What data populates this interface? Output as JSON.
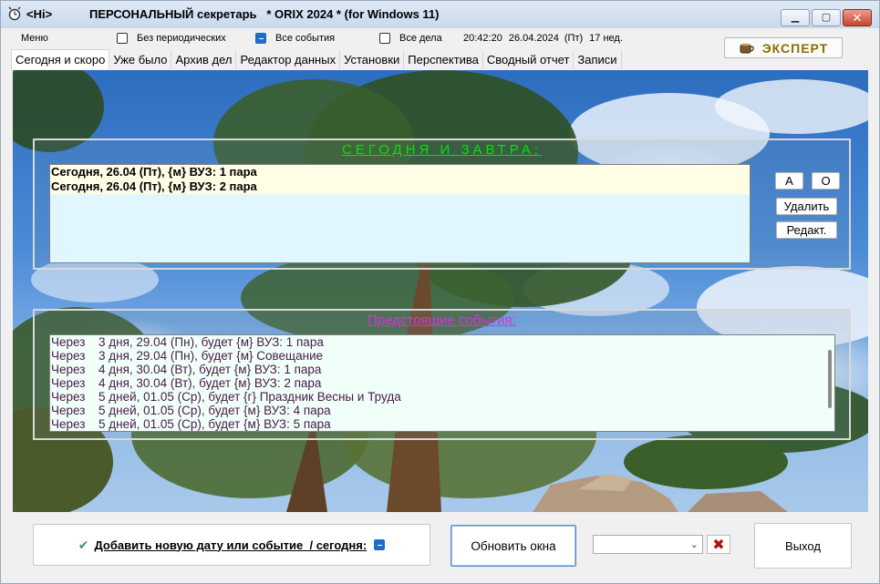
{
  "window": {
    "tag": "<Hi>",
    "title": "ПЕРСОНАЛЬНЫЙ секретарь   * ORIX 2024 * (for Windows 11)"
  },
  "options": {
    "menu": "Меню",
    "no_periodic": "Без периодических",
    "no_periodic_checked": false,
    "all_events": "Все события",
    "all_events_checked": true,
    "all_tasks": "Все дела",
    "all_tasks_checked": false,
    "time": "20:42:20",
    "date": "26.04.2024",
    "weekday": "(Пт)",
    "week": "17 нед."
  },
  "expert_button": "ЭКСПЕРТ",
  "tabs": [
    {
      "label": "Сегодня и скоро",
      "active": true
    },
    {
      "label": "Уже было",
      "active": false
    },
    {
      "label": "Архив дел",
      "active": false
    },
    {
      "label": "Редактор данных",
      "active": false
    },
    {
      "label": "Установки",
      "active": false
    },
    {
      "label": "Перспектива",
      "active": false
    },
    {
      "label": "Сводный отчет",
      "active": false
    },
    {
      "label": "Записи",
      "active": false
    }
  ],
  "today": {
    "heading": "СЕГОДНЯ И ЗАВТРА:",
    "items": [
      "Сегодня, 26.04 (Пт), {м} ВУЗ: 1 пара",
      "Сегодня, 26.04 (Пт), {м} ВУЗ: 2 пара"
    ],
    "btn_a": "А",
    "btn_o": "О",
    "btn_delete": "Удалить",
    "btn_edit": "Редакт."
  },
  "upcoming": {
    "heading": "Предстоящие события:",
    "items": [
      {
        "prefix": "Через",
        "text": "3 дня, 29.04 (Пн), будет {м} ВУЗ: 1 пара"
      },
      {
        "prefix": "Через",
        "text": "3 дня, 29.04 (Пн), будет {м} Совещание"
      },
      {
        "prefix": "Через",
        "text": "4 дня, 30.04 (Вт), будет {м} ВУЗ: 1 пара"
      },
      {
        "prefix": "Через",
        "text": "4 дня, 30.04 (Вт), будет {м} ВУЗ: 2 пара"
      },
      {
        "prefix": "Через",
        "text": "5 дней, 01.05 (Ср), будет {г} Праздник Весны и Труда"
      },
      {
        "prefix": "Через",
        "text": "5 дней, 01.05 (Ср), будет {м} ВУЗ: 4 пара"
      },
      {
        "prefix": "Через",
        "text": "5 дней, 01.05 (Ср), будет {м} ВУЗ: 5 пара"
      }
    ]
  },
  "bottom": {
    "add_label": "Добавить новую дату или событие  / сегодня:",
    "add_today_checked": true,
    "refresh": "Обновить окна",
    "exit": "Выход",
    "dropdown_value": ""
  }
}
